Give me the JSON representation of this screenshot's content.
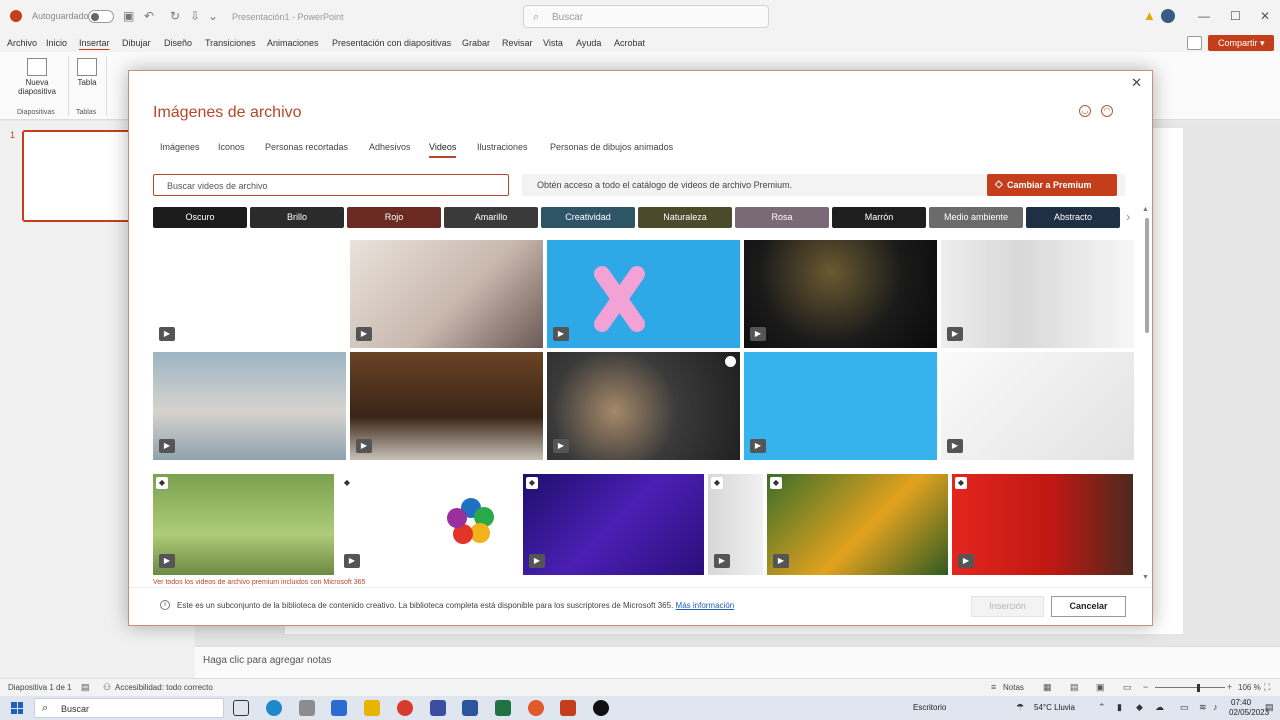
{
  "app": {
    "autosave_label": "Autoguardado",
    "filename": "Presentación1 - PowerPoint",
    "search_placeholder": "Buscar",
    "share_label": "Compartir",
    "accent_color": "#c43e1c"
  },
  "ribbon": {
    "tabs": [
      "Archivo",
      "Inicio",
      "Insertar",
      "Dibujar",
      "Diseño",
      "Transiciones",
      "Animaciones",
      "Presentación con diapositivas",
      "Grabar",
      "Revisar",
      "Vista",
      "Ayuda",
      "Acrobat"
    ],
    "active_tab": "Insertar",
    "new_slide_label": "Nueva diapositiva",
    "table_label": "Tabla",
    "group_slides": "Diapositivas",
    "group_tables": "Tablas"
  },
  "slides_pane": {
    "slide_number": "1"
  },
  "notes": {
    "placeholder": "Haga clic para agregar notas"
  },
  "statusbar": {
    "slide_count": "Diapositiva 1 de 1",
    "accessibility": "Accesibilidad: todo correcto",
    "notes_label": "Notas",
    "zoom": "106 %",
    "zoom_level": 0.6
  },
  "taskbar": {
    "search_label": "Buscar",
    "desktop_label": "Escritorio",
    "weather": "54°C  Lluvia",
    "time": "07:40",
    "date": "02/05/2023"
  },
  "dialog": {
    "title": "Imágenes de archivo",
    "tabs": [
      "Imágenes",
      "Iconos",
      "Personas recortadas",
      "Adhesivos",
      "Videos",
      "Ilustraciones",
      "Personas de dibujos animados"
    ],
    "active_tab": "Videos",
    "search_placeholder": "Buscar videos de archivo",
    "premium_text": "Obtén acceso a todo el catálogo de videos de archivo Premium.",
    "premium_button": "Cambiar a Premium",
    "chips": [
      {
        "label": "Oscuro",
        "color": "#1c1c1c"
      },
      {
        "label": "Brillo",
        "color": "#2b2b2b"
      },
      {
        "label": "Rojo",
        "color": "#6b2a22"
      },
      {
        "label": "Amarillo",
        "color": "#3a3a3a"
      },
      {
        "label": "Creatividad",
        "color": "#2d5566"
      },
      {
        "label": "Naturaleza",
        "color": "#4b4a2a"
      },
      {
        "label": "Rosa",
        "color": "#7a6a78"
      },
      {
        "label": "Marrón",
        "color": "#1e1e1e"
      },
      {
        "label": "Medio ambiente",
        "color": "#6b6b6b"
      },
      {
        "label": "Abstracto",
        "color": "#1f3045"
      }
    ],
    "see_all_text": "Ver todos los videos de archivo premium incluidos con Microsoft 365",
    "info_text": "Este es un subconjunto de la biblioteca de contenido creativo. La biblioteca completa está disponible para los suscriptores de Microsoft 365.",
    "info_link": "Más información",
    "insert_button": "Inserción",
    "cancel_button": "Cancelar"
  }
}
